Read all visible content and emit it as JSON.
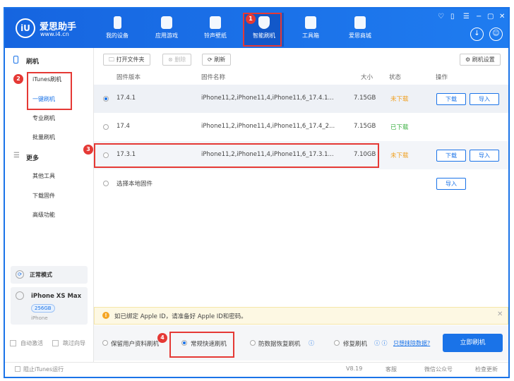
{
  "app": {
    "logo_text": "iU",
    "name": "爱思助手",
    "url": "www.i4.cn"
  },
  "nav": [
    {
      "label": "我的设备",
      "icon": "phone-icon"
    },
    {
      "label": "应用游戏",
      "icon": "cube-icon"
    },
    {
      "label": "铃声壁纸",
      "icon": "music-folder-icon"
    },
    {
      "label": "智能刷机",
      "icon": "shield-refresh-icon",
      "active": true
    },
    {
      "label": "工具箱",
      "icon": "toolbox-icon"
    },
    {
      "label": "爱思商城",
      "icon": "shopping-bag-icon"
    }
  ],
  "window_controls": [
    "shirt-icon",
    "note-icon",
    "menu-icon",
    "minimize-icon",
    "maximize-icon",
    "close-icon"
  ],
  "sidebar": {
    "section1": "刷机",
    "items1": [
      "iTunes刷机",
      "一键刷机",
      "专业刷机",
      "批量刷机"
    ],
    "section2": "更多",
    "items2": [
      "其他工具",
      "下载固件",
      "高级功能"
    ],
    "mode": "正常模式",
    "device": {
      "name": "iPhone XS Max",
      "storage": "256GB",
      "type": "iPhone"
    },
    "auto_activate": "自动激活",
    "skip_guide": "跳过向导"
  },
  "toolbar": {
    "open_folder": "打开文件夹",
    "delete": "删除",
    "refresh": "刷新",
    "settings": "刷机设置"
  },
  "table": {
    "headers": [
      "固件版本",
      "固件名称",
      "大小",
      "状态",
      "操作"
    ],
    "rows": [
      {
        "version": "17.4.1",
        "name": "iPhone11,2,iPhone11,4,iPhone11,6_17.4.1...",
        "size": "7.15GB",
        "status": "未下载",
        "selected": true,
        "actions": [
          "下载",
          "导入"
        ]
      },
      {
        "version": "17.4",
        "name": "iPhone11,2,iPhone11,4,iPhone11,6_17.4_2...",
        "size": "7.15GB",
        "status": "已下载",
        "actions": []
      },
      {
        "version": "17.3.1",
        "name": "iPhone11,2,iPhone11,4,iPhone11,6_17.3.1...",
        "size": "7.10GB",
        "status": "未下载",
        "actions": [
          "下载",
          "导入"
        ]
      },
      {
        "version": "选择本地固件",
        "name": "",
        "size": "",
        "status": "",
        "actions": [
          "导入"
        ]
      }
    ]
  },
  "notice": "如已绑定 Apple ID，请准备好 Apple ID和密码。",
  "options": [
    "保留用户资料刷机",
    "常规快速刷机",
    "防数据恢复刷机",
    "修复刷机"
  ],
  "erase_link": "只想抹除数据?",
  "flash_button": "立即刷机",
  "footer": {
    "block_itunes": "阻止iTunes运行",
    "version": "V8.19",
    "support": "客服",
    "wechat": "微信公众号",
    "update": "检查更新"
  },
  "annotations": [
    "1",
    "2",
    "3",
    "4"
  ],
  "colors": {
    "brand": "#1a73e8",
    "not_downloaded": "#f0a020",
    "downloaded": "#3cb043",
    "highlight": "#e53935"
  }
}
